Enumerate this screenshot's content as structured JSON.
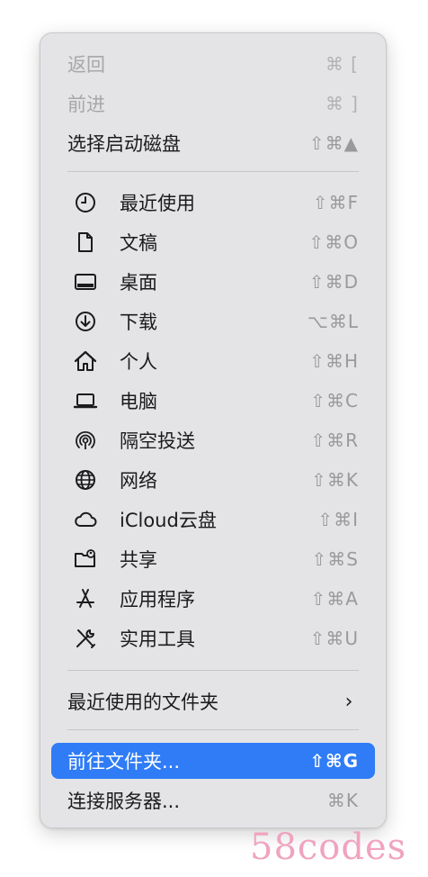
{
  "menu": {
    "nav": [
      {
        "label": "返回",
        "shortcut": "⌘ [",
        "enabled": false
      },
      {
        "label": "前进",
        "shortcut": "⌘ ]",
        "enabled": false
      },
      {
        "label": "选择启动磁盘",
        "shortcut": "⇧⌘▲",
        "enabled": true
      }
    ],
    "places": [
      {
        "icon": "clock-icon",
        "label": "最近使用",
        "shortcut": "⇧⌘F"
      },
      {
        "icon": "document-icon",
        "label": "文稿",
        "shortcut": "⇧⌘O"
      },
      {
        "icon": "desktop-icon",
        "label": "桌面",
        "shortcut": "⇧⌘D"
      },
      {
        "icon": "download-icon",
        "label": "下载",
        "shortcut": "⌥⌘L"
      },
      {
        "icon": "home-icon",
        "label": "个人",
        "shortcut": "⇧⌘H"
      },
      {
        "icon": "laptop-icon",
        "label": "电脑",
        "shortcut": "⇧⌘C"
      },
      {
        "icon": "airdrop-icon",
        "label": "隔空投送",
        "shortcut": "⇧⌘R"
      },
      {
        "icon": "network-globe-icon",
        "label": "网络",
        "shortcut": "⇧⌘K"
      },
      {
        "icon": "cloud-icon",
        "label": "iCloud云盘",
        "shortcut": "⇧⌘I"
      },
      {
        "icon": "shared-folder-icon",
        "label": "共享",
        "shortcut": "⇧⌘S"
      },
      {
        "icon": "applications-icon",
        "label": "应用程序",
        "shortcut": "⇧⌘A"
      },
      {
        "icon": "utilities-tools-icon",
        "label": "实用工具",
        "shortcut": "⇧⌘U"
      }
    ],
    "recent_folders": {
      "label": "最近使用的文件夹",
      "chevron": "›"
    },
    "goto_folder": {
      "label": "前往文件夹...",
      "shortcut": "⇧⌘G"
    },
    "connect_server": {
      "label": "连接服务器...",
      "shortcut": "⌘K"
    }
  },
  "colors": {
    "menu_bg": "#e4e4e6",
    "highlight": "#2f7cf6",
    "disabled_text": "#a7a7aa",
    "watermark": "#f0a3c0"
  },
  "watermark": "58codes"
}
